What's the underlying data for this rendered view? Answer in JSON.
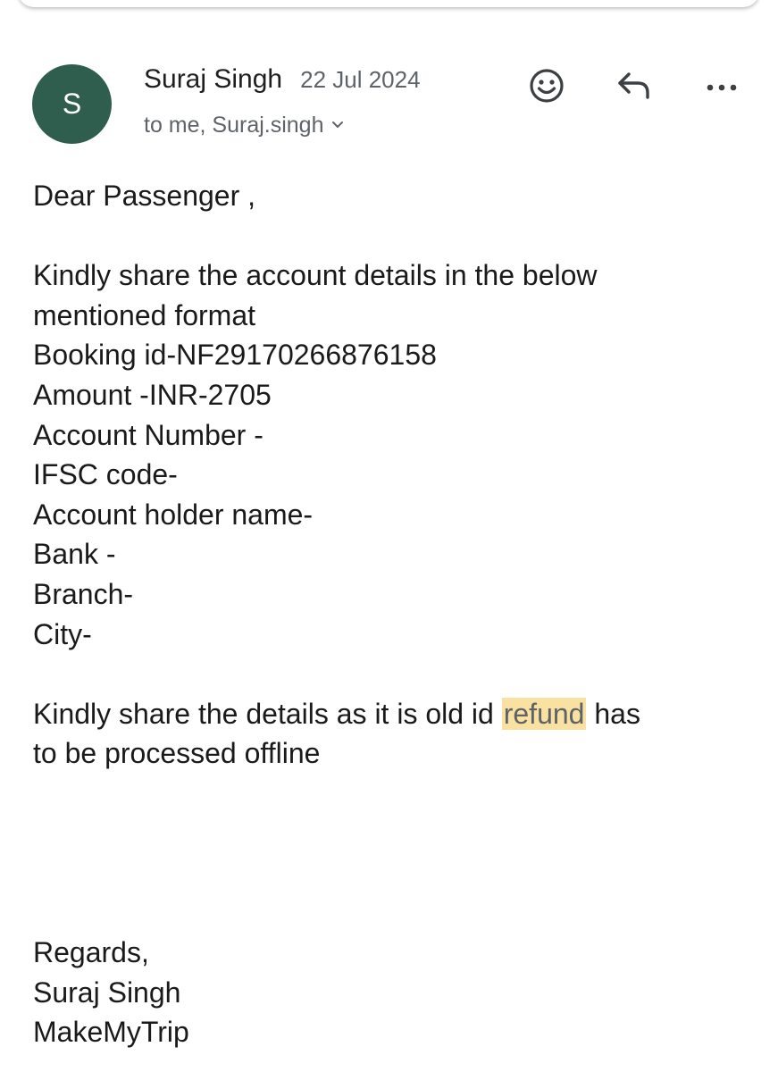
{
  "header": {
    "avatar_letter": "S",
    "sender_name": "Suraj Singh",
    "date": "22 Jul 2024",
    "recipients": "to me, Suraj.singh"
  },
  "icons": {
    "emoji": "smiley-icon",
    "reply": "reply-arrow-icon",
    "more": "more-dots-icon",
    "expand": "chevron-down-icon"
  },
  "colors": {
    "avatar_bg": "#2f5e4e",
    "highlight": "#f8e1a1"
  },
  "body": {
    "greeting": "Dear Passenger ,",
    "intro_line1": "Kindly share the account details in the below",
    "intro_line2": "mentioned format",
    "fields": [
      "Booking id-NF29170266876158",
      "Amount -INR-2705",
      "Account Number -",
      "IFSC code-",
      "Account holder name-",
      "Bank -",
      "Branch-",
      "City-"
    ],
    "note_prefix": "Kindly share the details as it is old id ",
    "note_highlight": "refund",
    "note_suffix": " has",
    "note_line2": "to be processed offline",
    "signoff": [
      "Regards,",
      "Suraj Singh",
      "MakeMyTrip"
    ]
  }
}
